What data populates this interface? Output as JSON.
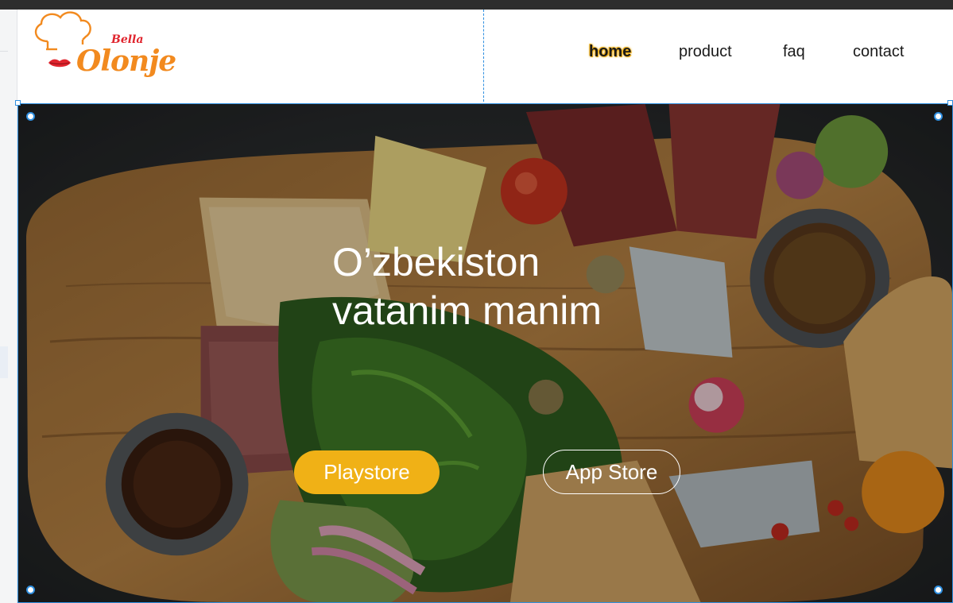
{
  "brand": {
    "logo_script": "Olonje",
    "logo_small": "Bella"
  },
  "nav": {
    "items": [
      {
        "label": "home",
        "active": true
      },
      {
        "label": "product",
        "active": false
      },
      {
        "label": "faq",
        "active": false
      },
      {
        "label": "contact",
        "active": false
      }
    ]
  },
  "hero": {
    "title_line1": "O’zbekiston",
    "title_line2": "vatanim manim",
    "playstore_label": "Playstore",
    "appstore_label": "App Store"
  },
  "colors": {
    "accent": "#f0b116",
    "logo_orange": "#f28a1f",
    "logo_red": "#e0252e",
    "selection_blue": "#2f8fe0",
    "top_strip": "#2d2d2d"
  },
  "icons": [
    "chef-hat-icon",
    "lips-icon"
  ]
}
